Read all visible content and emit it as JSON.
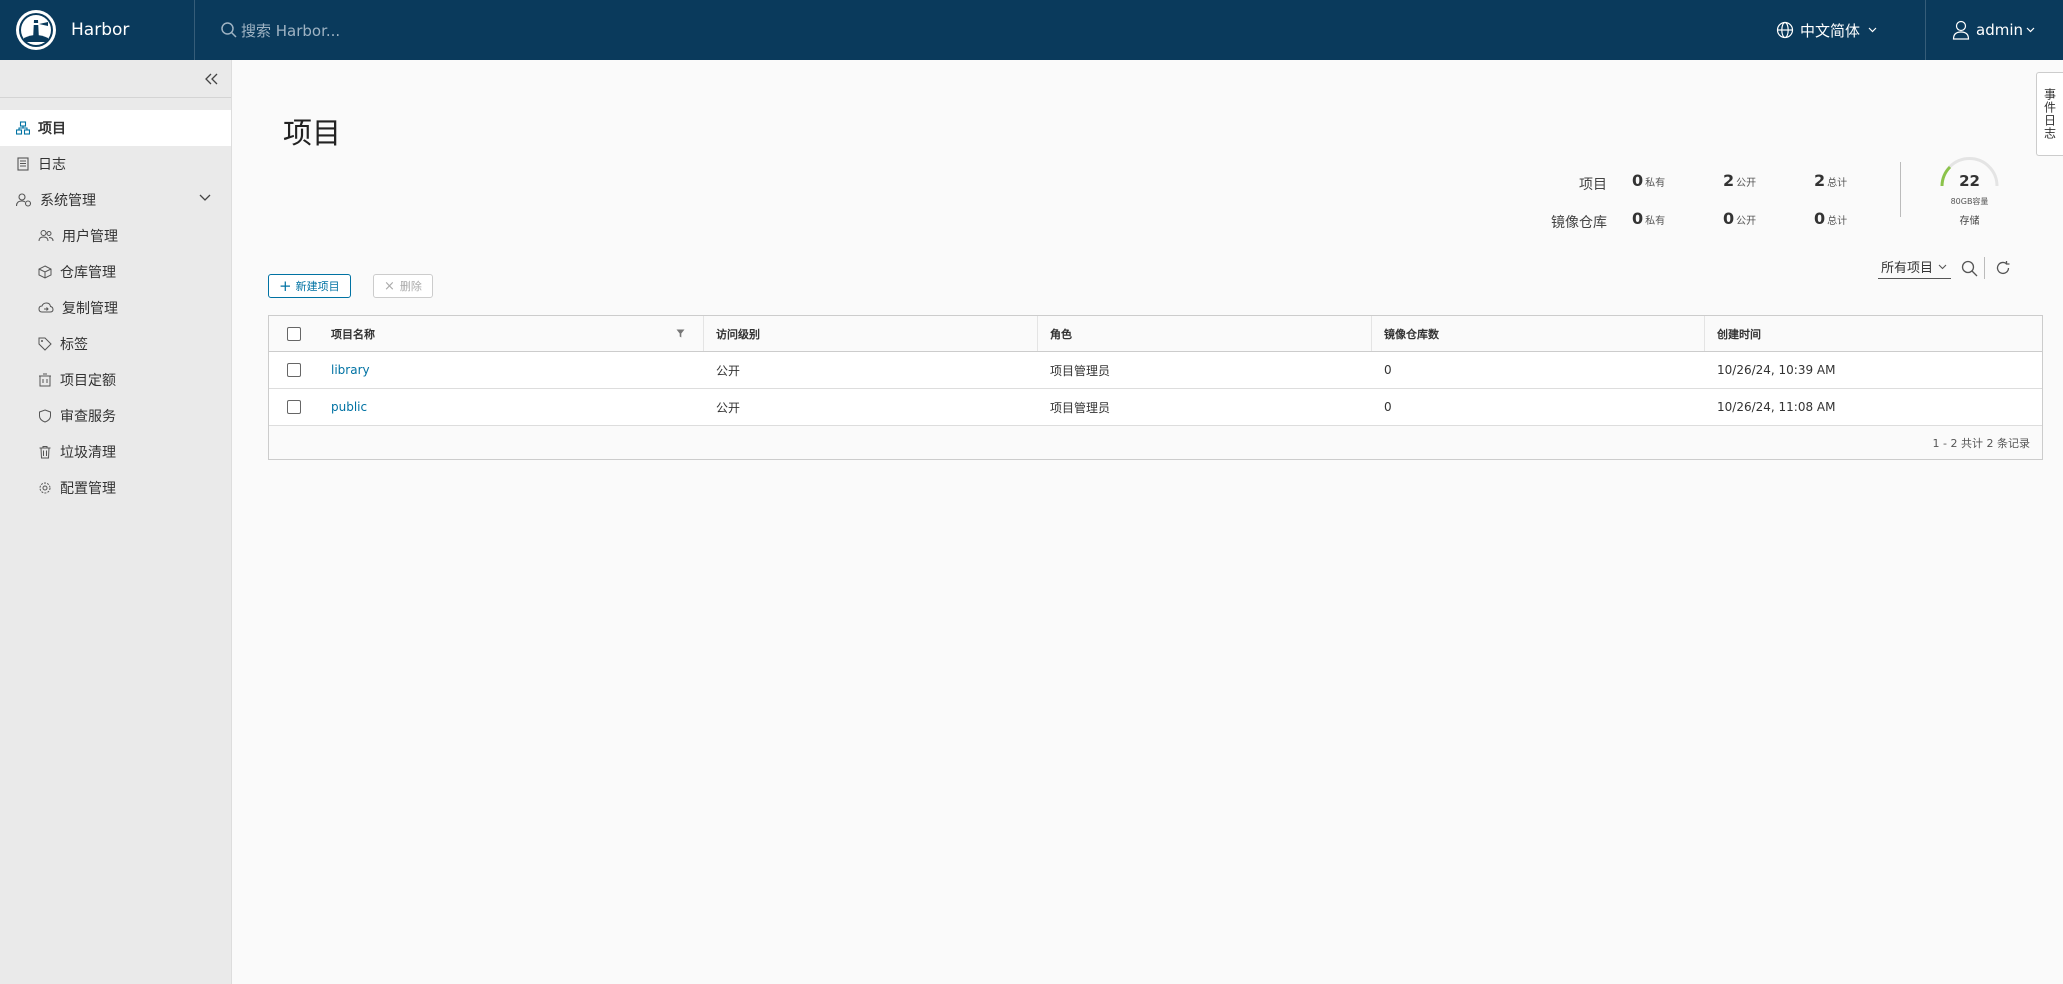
{
  "header": {
    "app_name": "Harbor",
    "search_placeholder": "搜索 Harbor...",
    "language": "中文简体",
    "user": "admin",
    "brand_color": "#0a3a5c"
  },
  "sidebar": {
    "items": [
      {
        "label": "项目",
        "icon": "projects-icon"
      },
      {
        "label": "日志",
        "icon": "logs-icon"
      },
      {
        "label": "系统管理",
        "icon": "admin-icon"
      }
    ],
    "admin_items": [
      {
        "label": "用户管理",
        "icon": "users-icon"
      },
      {
        "label": "仓库管理",
        "icon": "registry-icon"
      },
      {
        "label": "复制管理",
        "icon": "replication-icon"
      },
      {
        "label": "标签",
        "icon": "tag-icon"
      },
      {
        "label": "项目定额",
        "icon": "quota-icon"
      },
      {
        "label": "审查服务",
        "icon": "shield-icon"
      },
      {
        "label": "垃圾清理",
        "icon": "trash-icon"
      },
      {
        "label": "配置管理",
        "icon": "gear-icon"
      }
    ]
  },
  "main": {
    "title": "项目",
    "stats": {
      "projects_label": "项目",
      "repos_label": "镜像仓库",
      "private_unit": "私有",
      "public_unit": "公开",
      "total_unit": "总计",
      "projects_private": "0",
      "projects_public": "2",
      "projects_total": "2",
      "repos_private": "0",
      "repos_public": "0",
      "repos_total": "0"
    },
    "storage": {
      "value": "22",
      "capacity": "80GB容量",
      "label": "存储"
    },
    "new_button": "新建项目",
    "delete_button": "删除",
    "filter_select": "所有项目",
    "table": {
      "headers": [
        "项目名称",
        "访问级别",
        "角色",
        "镜像仓库数",
        "创建时间"
      ],
      "rows": [
        [
          "library",
          "公开",
          "项目管理员",
          "0",
          "10/26/24, 10:39 AM"
        ],
        [
          "public",
          "公开",
          "项目管理员",
          "0",
          "10/26/24, 11:08 AM"
        ]
      ],
      "footer": "1 - 2 共计 2 条记录"
    },
    "event_log_tab": "事件日志"
  }
}
